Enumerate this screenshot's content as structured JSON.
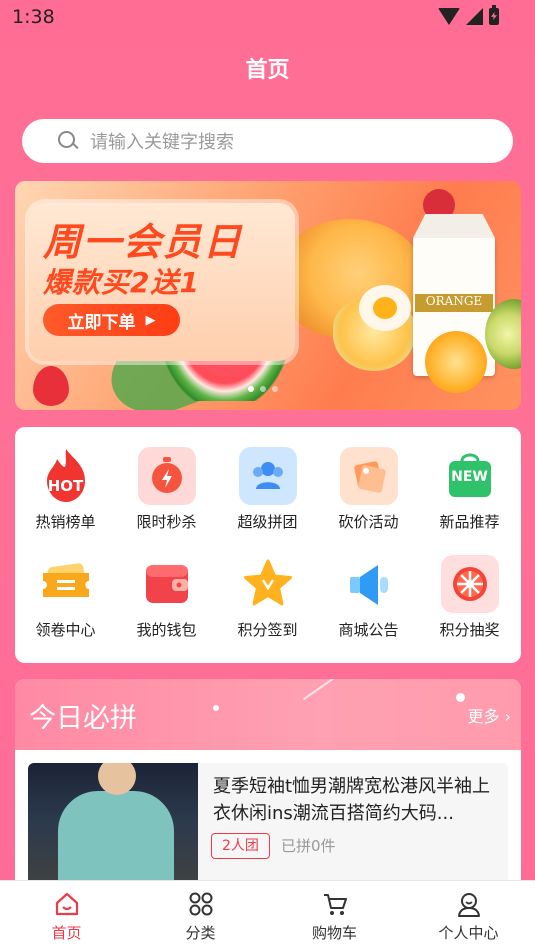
{
  "status_bar": {
    "time": "1:38"
  },
  "header": {
    "title": "首页"
  },
  "search": {
    "placeholder": "请输入关键字搜索"
  },
  "banner": {
    "headline": "周一会员日",
    "subline": "爆款买2送1",
    "button_label": "立即下单",
    "carton_label": "ORANGE",
    "slides": 3,
    "active_slide": 0
  },
  "grid": [
    {
      "label": "热销榜单",
      "icon": "hot-flame-icon"
    },
    {
      "label": "限时秒杀",
      "icon": "stopwatch-icon"
    },
    {
      "label": "超级拼团",
      "icon": "group-icon"
    },
    {
      "label": "砍价活动",
      "icon": "price-tag-icon"
    },
    {
      "label": "新品推荐",
      "icon": "new-bag-icon"
    },
    {
      "label": "领卷中心",
      "icon": "coupon-icon"
    },
    {
      "label": "我的钱包",
      "icon": "wallet-icon"
    },
    {
      "label": "积分签到",
      "icon": "star-icon"
    },
    {
      "label": "商城公告",
      "icon": "megaphone-icon"
    },
    {
      "label": "积分抽奖",
      "icon": "wheel-icon"
    }
  ],
  "hot_badge": "HOT",
  "new_badge": "NEW",
  "section": {
    "title": "今日必拼",
    "more_label": "更多",
    "product": {
      "title": "夏季短袖t恤男潮牌宽松港风半袖上衣休闲ins潮流百搭简约大码...",
      "badge": "2人团",
      "sold": "已拼0件"
    }
  },
  "tabbar": [
    {
      "label": "首页",
      "icon": "home-icon",
      "active": true
    },
    {
      "label": "分类",
      "icon": "category-grid-icon",
      "active": false
    },
    {
      "label": "购物车",
      "icon": "cart-icon",
      "active": false
    },
    {
      "label": "个人中心",
      "icon": "user-icon",
      "active": false
    }
  ],
  "colors": {
    "brand": "#ff7097",
    "accent": "#ee3b4a"
  }
}
